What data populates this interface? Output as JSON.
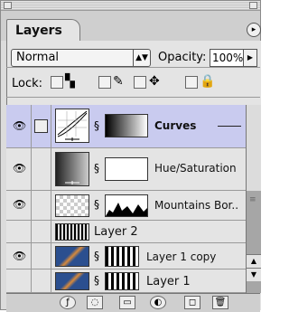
{
  "panel": {
    "tab_title": "Layers",
    "menu_arrow": "▸"
  },
  "options": {
    "blend_mode": "Normal",
    "opacity_label": "Opacity:",
    "opacity_value": "100%",
    "lock_label": "Lock:"
  },
  "layers": [
    {
      "name": "Curves",
      "visible": true,
      "selected": true,
      "kind": "adjustment"
    },
    {
      "name": "Hue/Saturation",
      "visible": true,
      "selected": false,
      "kind": "adjustment"
    },
    {
      "name": "Mountains Bor..",
      "visible": true,
      "selected": false,
      "kind": "masked"
    },
    {
      "name": "Layer 2",
      "visible": false,
      "selected": false,
      "kind": "pixel"
    },
    {
      "name": "Layer 1 copy",
      "visible": true,
      "selected": false,
      "kind": "masked"
    },
    {
      "name": "Layer 1",
      "visible": false,
      "selected": false,
      "kind": "masked"
    }
  ],
  "footer": {
    "icons": [
      "layer-style-icon",
      "mask-icon",
      "new-set-icon",
      "adjustment-layer-icon",
      "new-layer-icon",
      "trash-icon"
    ]
  },
  "colors": {
    "selected_row": "#c9cbef",
    "panel_bg": "#e4e4e4"
  }
}
